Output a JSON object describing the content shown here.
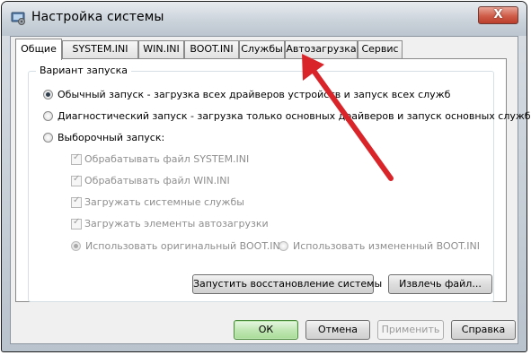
{
  "window": {
    "title": "Настройка системы",
    "icon": "system-config-icon",
    "close_symbol": "X"
  },
  "tabs": [
    {
      "label": "Общие",
      "active": true
    },
    {
      "label": "SYSTEM.INI",
      "active": false
    },
    {
      "label": "WIN.INI",
      "active": false
    },
    {
      "label": "BOOT.INI",
      "active": false
    },
    {
      "label": "Службы",
      "active": false
    },
    {
      "label": "Автозагрузка",
      "active": false
    },
    {
      "label": "Сервис",
      "active": false
    }
  ],
  "startup_group": {
    "legend": "Вариант запуска",
    "normal": {
      "label": "Обычный запуск - загрузка всех драйверов устройств и запуск всех служб",
      "checked": true
    },
    "diagnostic": {
      "label": "Диагностический запуск - загрузка только основных драйверов и запуск основных служб",
      "checked": false
    },
    "selective": {
      "label": "Выборочный запуск:",
      "checked": false
    },
    "options": [
      {
        "label": "Обрабатывать файл SYSTEM.INI",
        "checked": true
      },
      {
        "label": "Обрабатывать файл WIN.INI",
        "checked": true
      },
      {
        "label": "Загружать системные службы",
        "checked": true
      },
      {
        "label": "Загружать элементы автозагрузки",
        "checked": true
      }
    ],
    "boot_original": {
      "label": "Использовать оригинальный BOOT.INI",
      "checked": true
    },
    "boot_modified": {
      "label": "Использовать измененный BOOT.INI",
      "checked": false
    }
  },
  "panel_buttons": {
    "restore": "Запустить восстановление системы",
    "extract": "Извлечь файл..."
  },
  "footer_buttons": {
    "ok": "ОК",
    "cancel": "Отмена",
    "apply": "Применить",
    "help": "Справка"
  },
  "colors": {
    "annotation_arrow": "#d9252a",
    "ok_button": "#a8dc98",
    "close_button": "#cf5d49"
  }
}
